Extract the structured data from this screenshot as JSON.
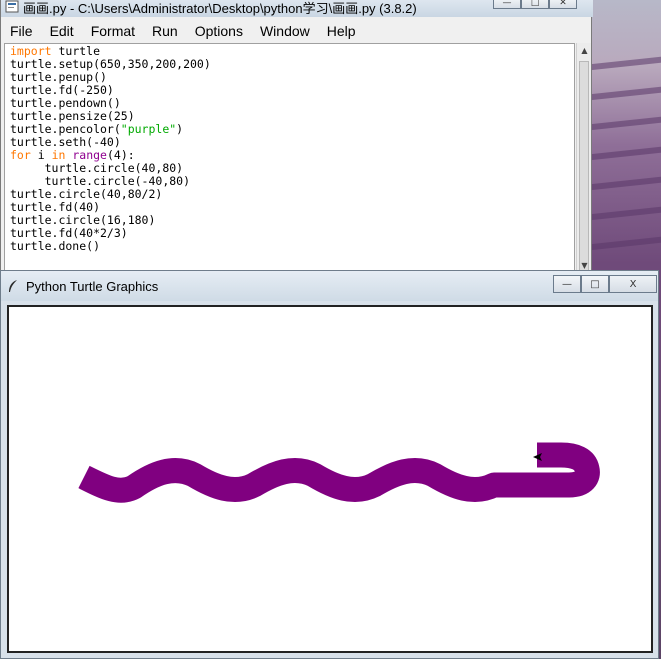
{
  "idle_window": {
    "title": "画画.py - C:\\Users\\Administrator\\Desktop\\python学习\\画画.py (3.8.2)",
    "menu": [
      "File",
      "Edit",
      "Format",
      "Run",
      "Options",
      "Window",
      "Help"
    ],
    "code_lines": [
      [
        {
          "t": "import",
          "c": "kw"
        },
        {
          "t": " turtle",
          "c": ""
        }
      ],
      [
        {
          "t": "turtle.setup(650,350,200,200)",
          "c": ""
        }
      ],
      [
        {
          "t": "turtle.penup()",
          "c": ""
        }
      ],
      [
        {
          "t": "turtle.fd(-250)",
          "c": ""
        }
      ],
      [
        {
          "t": "turtle.pendown()",
          "c": ""
        }
      ],
      [
        {
          "t": "turtle.pensize(25)",
          "c": ""
        }
      ],
      [
        {
          "t": "turtle.pencolor(",
          "c": ""
        },
        {
          "t": "\"purple\"",
          "c": "str"
        },
        {
          "t": ")",
          "c": ""
        }
      ],
      [
        {
          "t": "turtle.seth(-40)",
          "c": ""
        }
      ],
      [
        {
          "t": "for",
          "c": "kw"
        },
        {
          "t": " i ",
          "c": ""
        },
        {
          "t": "in",
          "c": "kw"
        },
        {
          "t": " ",
          "c": ""
        },
        {
          "t": "range",
          "c": "bi"
        },
        {
          "t": "(4):",
          "c": ""
        }
      ],
      [
        {
          "t": "     turtle.circle(40,80)",
          "c": ""
        }
      ],
      [
        {
          "t": "     turtle.circle(-40,80)",
          "c": ""
        }
      ],
      [
        {
          "t": "turtle.circle(40,80/2)",
          "c": ""
        }
      ],
      [
        {
          "t": "turtle.fd(40)",
          "c": ""
        }
      ],
      [
        {
          "t": "turtle.circle(16,180)",
          "c": ""
        }
      ],
      [
        {
          "t": "turtle.fd(40*2/3)",
          "c": ""
        }
      ],
      [
        {
          "t": "turtle.done()",
          "c": ""
        }
      ]
    ],
    "window_buttons": {
      "minimize": "—",
      "maximize": "□",
      "close": "✕"
    }
  },
  "turtle_window": {
    "title": "Python Turtle Graphics",
    "window_buttons": {
      "minimize": "—",
      "maximize": "□",
      "close": "X"
    },
    "drawing": {
      "pen_color": "#800080",
      "pensize": 25,
      "description_icon": "turtle-arrow-icon"
    }
  },
  "colors": {
    "keyword": "#ff7700",
    "builtin": "#900090",
    "string": "#00aa00",
    "snake": "#800080"
  }
}
